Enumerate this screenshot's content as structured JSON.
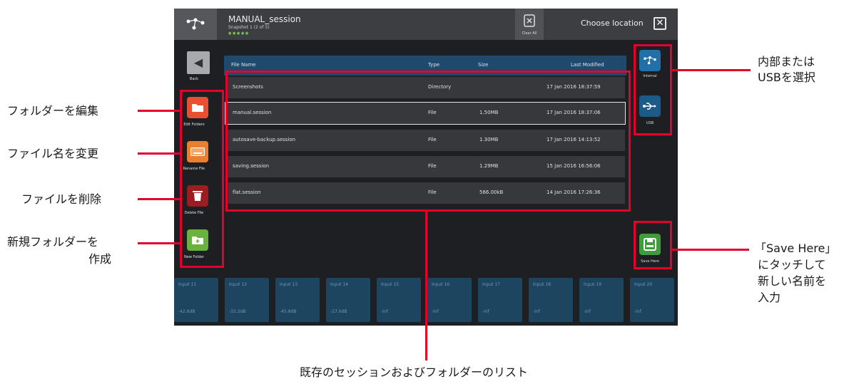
{
  "session": {
    "title": "MANUAL_session",
    "subtitle": "Snapshot 1 (2 of 5)",
    "indicator": "● ● ● ● ●"
  },
  "topbar": {
    "clear_all_label": "Clear All",
    "choose_location": "Choose location",
    "close_symbol": "✕"
  },
  "sidebar": {
    "back_label": "Back",
    "buttons": [
      {
        "label": "Edit Folders",
        "color": "#e8502f",
        "icon": "folder-icon"
      },
      {
        "label": "Rename File",
        "color": "#e98030",
        "icon": "keyboard-icon"
      },
      {
        "label": "Delete File",
        "color": "#9c1c22",
        "icon": "trash-icon"
      },
      {
        "label": "New Folder",
        "color": "#6ab23e",
        "icon": "new-folder-icon"
      }
    ]
  },
  "files": {
    "columns": [
      "File Name",
      "Type",
      "Size",
      "Last Modified"
    ],
    "rows": [
      {
        "name": "Screenshots",
        "type": "Directory",
        "size": "",
        "modified": "17 Jan 2016 18:37:59"
      },
      {
        "name": "manual.session",
        "type": "File",
        "size": "1.50MB",
        "modified": "17 Jan 2016 18:37:06"
      },
      {
        "name": "autosave-backup.session",
        "type": "File",
        "size": "1.30MB",
        "modified": "17 Jan 2016 14:13:52"
      },
      {
        "name": "saving.session",
        "type": "File",
        "size": "1.29MB",
        "modified": "15 Jan 2016 16:56:06"
      },
      {
        "name": "flat.session",
        "type": "File",
        "size": "566.00kB",
        "modified": "14 Jan 2016 17:26:36"
      }
    ]
  },
  "locations": {
    "internal_label": "Internal",
    "usb_label": "USB",
    "save_here_label": "Save Here",
    "save_color": "#3f9c3a"
  },
  "channels": [
    {
      "name": "Input 11",
      "value": "-42.6dB"
    },
    {
      "name": "Input 12",
      "value": "-33.2dB"
    },
    {
      "name": "Input 13",
      "value": "-45.8dB"
    },
    {
      "name": "Input 14",
      "value": "-27.0dB"
    },
    {
      "name": "Input 15",
      "value": "-inf"
    },
    {
      "name": "Input 16",
      "value": "-inf"
    },
    {
      "name": "Input 17",
      "value": "-inf"
    },
    {
      "name": "Input 18",
      "value": "-inf"
    },
    {
      "name": "Input 19",
      "value": "-inf"
    },
    {
      "name": "Input 20",
      "value": "-inf"
    }
  ],
  "annotations": {
    "edit_folders": "フォルダーを編集",
    "rename_file": "ファイル名を変更",
    "delete_file": "ファイルを削除",
    "new_folder_line1": "新規フォルダーを",
    "new_folder_line2": "作成",
    "select_line1": "内部または",
    "select_line2": "USBを選択",
    "save_line1": "「Save Here」",
    "save_line2": "にタッチして",
    "save_line3": "新しい名前を",
    "save_line4": "入力",
    "list": "既存のセッションおよびフォルダーのリスト"
  },
  "accent_red": "#e4002b"
}
